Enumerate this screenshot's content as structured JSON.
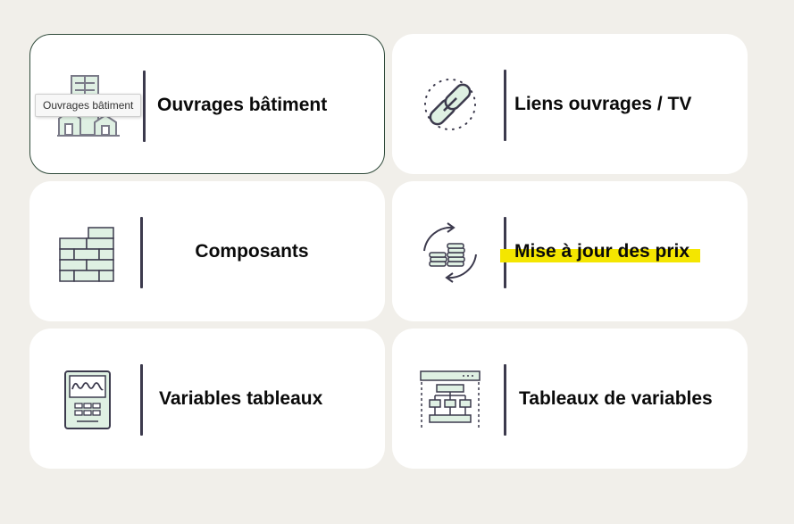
{
  "cards": [
    {
      "label": "Ouvrages bâtiment",
      "icon": "building-icon"
    },
    {
      "label": "Liens ouvrages / TV",
      "icon": "chain-link-icon"
    },
    {
      "label": "Composants",
      "icon": "brick-wall-icon"
    },
    {
      "label": "Mise à jour des prix",
      "icon": "price-update-icon"
    },
    {
      "label": "Variables tableaux",
      "icon": "meter-panel-icon"
    },
    {
      "label": "Tableaux de variables",
      "icon": "flowchart-table-icon"
    }
  ],
  "tooltip": "Ouvrages bâtiment",
  "colors": {
    "background": "#f1efea",
    "card": "#ffffff",
    "icon_fill": "#dff0e3",
    "icon_stroke": "#3c3a4d",
    "highlight": "#f4e600"
  }
}
